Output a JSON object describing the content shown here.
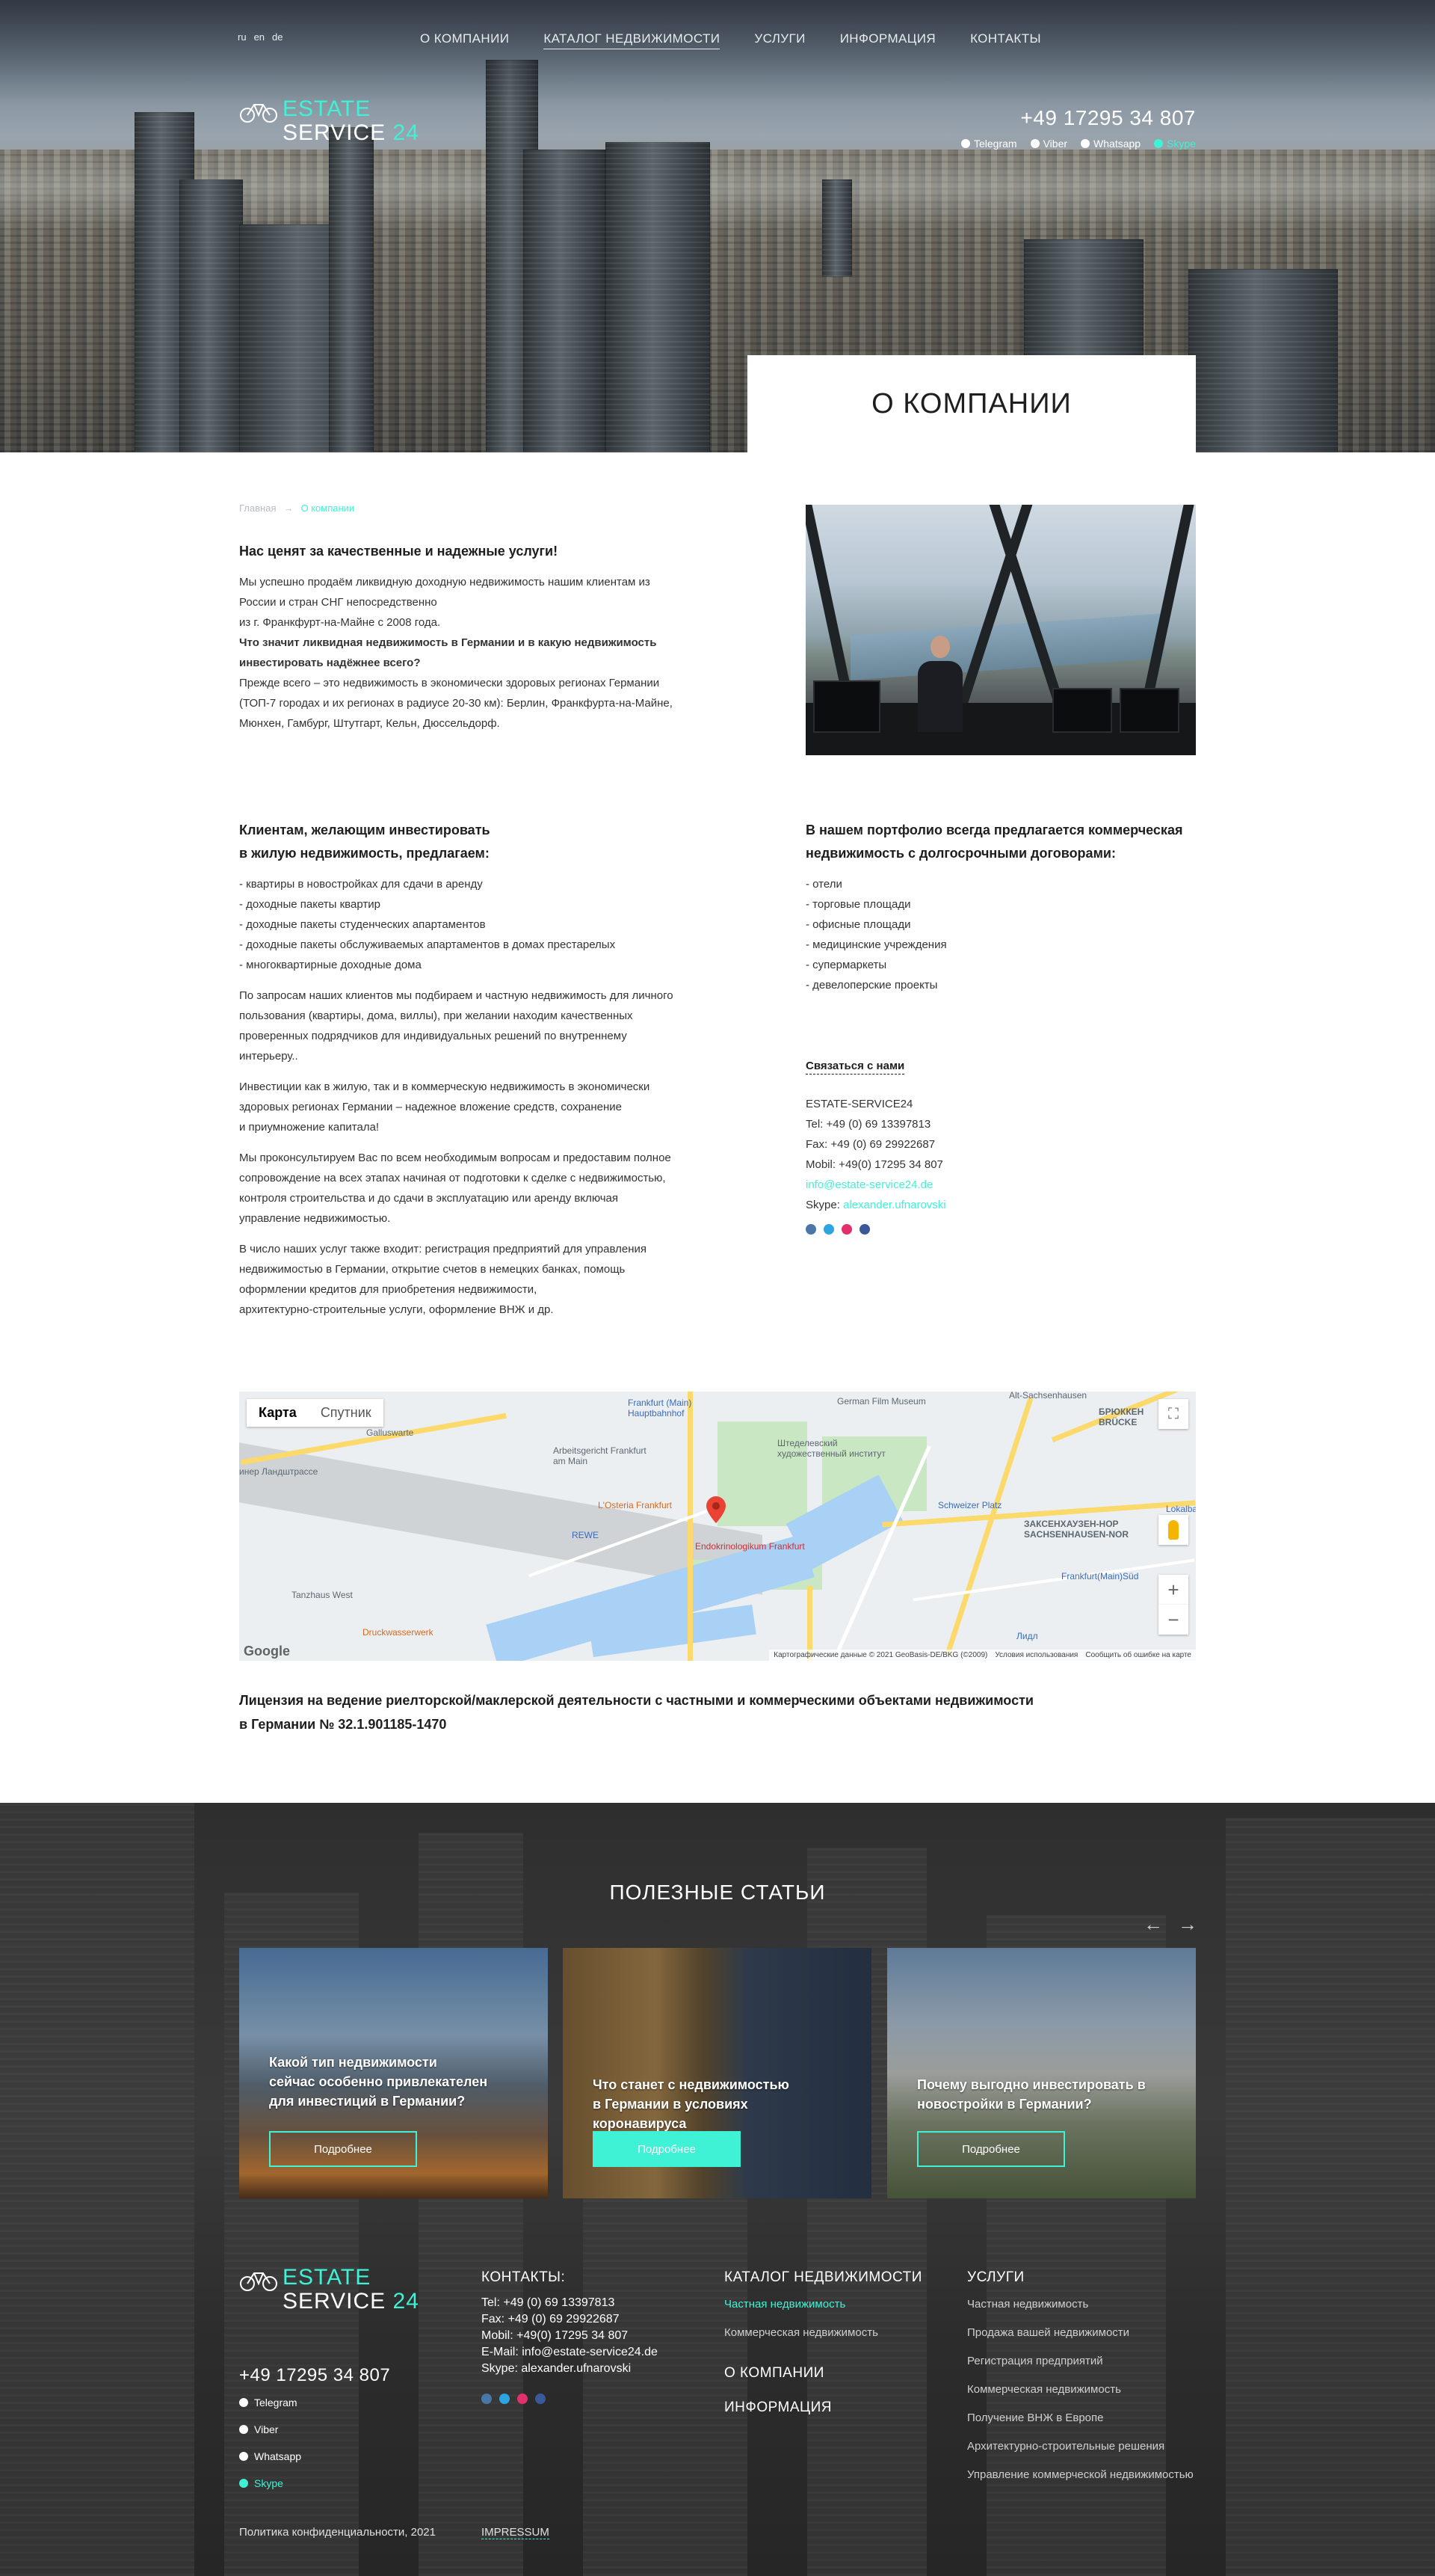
{
  "header": {
    "languages": [
      "ru",
      "en",
      "de"
    ],
    "nav": [
      {
        "label": "О КОМПАНИИ",
        "active": false
      },
      {
        "label": "КАТАЛОГ НЕДВИЖИМОСТИ",
        "active": true
      },
      {
        "label": "УСЛУГИ",
        "active": false
      },
      {
        "label": "ИНФОРМАЦИЯ",
        "active": false
      },
      {
        "label": "КОНТАКТЫ",
        "active": false
      }
    ],
    "logo": {
      "line1": "ESTATE",
      "line2": "SERVICE",
      "num": "24",
      "icon": "bicycle-icon"
    },
    "phone": "+49 17295 34 807",
    "messengers": [
      {
        "label": "Telegram",
        "icon": "telegram-icon"
      },
      {
        "label": "Viber",
        "icon": "viber-icon"
      },
      {
        "label": "Whatsapp",
        "icon": "whatsapp-icon"
      },
      {
        "label": "Skype",
        "icon": "skype-icon"
      }
    ],
    "page_title": "О КОМПАНИИ"
  },
  "breadcrumb": {
    "home": "Главная",
    "separator": "→",
    "current": "О компании"
  },
  "intro": {
    "heading": "Нас ценят за качественные и надежные услуги!",
    "p1_line1": "Мы успешно продаём ликвидную доходную недвижимость нашим клиентам из",
    "p1_line2": "России и стран СНГ непосредственно",
    "p1_line3": "из г. Франкфурт-на-Майне с  2008 года.",
    "question_line1": "Что значит ликвидная недвижимость в Германии и в какую недвижимость",
    "question_line2": "инвестировать надёжнее всего?",
    "answer_line1": "Прежде всего – это недвижимость в экономически здоровых регионах Германии",
    "answer_line2": "(ТОП-7 городах и их регионах в радиусе 20-30 км): Берлин, Франкфурта-на-Майне,",
    "answer_line3": "Мюнхен, Гамбург, Штутгарт, Кельн, Дюссельдорф."
  },
  "residential": {
    "heading_line1": "Клиентам, желающим инвестировать",
    "heading_line2": "в жилую недвижимость, предлагаем:",
    "items": [
      "- квартиры в новостройках для сдачи в аренду",
      "- доходные пакеты квартир",
      "- доходные пакеты студенческих апартаментов",
      "- доходные пакеты обслуживаемых апартаментов в домах престарелых",
      "- многоквартирные доходные дома"
    ],
    "p_private": [
      "По запросам наших клиентов мы подбираем и частную недвижимость для личного",
      "пользования (квартиры, дома, виллы), при желании находим качественных",
      "проверенных подрядчиков для индивидуальных решений по внутреннему",
      "интерьеру.."
    ],
    "p_invest": [
      "Инвестиции как в жилую, так и в коммерческую недвижимость в экономически",
      "здоровых регионах Германии – надежное вложение средств, сохранение",
      "и приумножение капитала!"
    ],
    "p_consult": [
      "Мы проконсультируем Вас по всем необходимым вопросам и предоставим полное",
      "сопровождение на всех этапах начиная от подготовки к сделке с недвижимостью,",
      "контроля строительства и до сдачи в эксплуатацию или аренду включая",
      "управление недвижимостью."
    ],
    "p_services": [
      "В число наших услуг также входит: регистрация предприятий для управления",
      "недвижимостью в Германии, открытие счетов в немецких банках, помощь",
      "оформлении кредитов для приобретения недвижимости,",
      "архитектурно-строительные услуги, оформление ВНЖ и др."
    ]
  },
  "commercial": {
    "heading_line1": "В нашем портфолио всегда предлагается коммерческая",
    "heading_line2": "недвижимость с долгосрочными договорами:",
    "items": [
      "- отели",
      "- торговые площади",
      "- офисные площади",
      "- медицинские учреждения",
      "- супермаркеты",
      "- девелоперские проекты"
    ]
  },
  "contact": {
    "heading": "Связаться с нами",
    "company": "ESTATE-SERVICE24",
    "tel": "Tel: +49 (0) 69 13397813",
    "fax": "Fax: +49 (0) 69 29922687",
    "mobil": "Mobil: +49(0) 17295 34 807",
    "email": "info@estate-service24.de",
    "skype_label": "Skype:",
    "skype": "alexander.ufnarovski",
    "socials": [
      "vk-icon",
      "telegram-icon",
      "instagram-icon",
      "facebook-icon"
    ]
  },
  "map": {
    "tab_map": "Карта",
    "tab_satellite": "Спутник",
    "labels": {
      "galluswarte": "Galluswarte",
      "arbeitsgericht": "Arbeitsgericht Frankfurt am Main",
      "hauptbahnhof": "Frankfurt (Main) Hauptbahnhof",
      "lostetia": "L'Osteria Frankfurt",
      "rewe": "REWE",
      "endo": "Endokrinologikum Frankfurt",
      "tanzhaus": "Tanzhaus West",
      "druck": "Druckwasserwerk",
      "schweizer": "Schweizer Platz",
      "sachsenhausen": "ЗАКСЕНХАУЗЕН-НОР SACHSENHAUSEN-NOR",
      "brucken": "БРЮККЕН BRÜCKE",
      "lokal": "Lokalbahnh",
      "sudbf": "Frankfurt(Main)Süd",
      "lidl": "Лидл",
      "staedel": "Штеделевский художественный институт",
      "film": "German Film Museum",
      "alt": "Alt-Sachsenhausen",
      "mannheimer": "инер Ландштрассе"
    },
    "google": "Google",
    "footer_data": "Картографические данные © 2021 GeoBasis-DE/BKG (©2009)",
    "footer_terms": "Условия использования",
    "footer_report": "Сообщить об ошибке на карте"
  },
  "license": {
    "line1": "Лицензия на ведение риелторской/маклерской деятельности с частными и коммерческими объектами недвижимости",
    "line2": "в Германии № 32.1.901185-1470"
  },
  "articles": {
    "title": "ПОЛЕЗНЫЕ СТАТЬИ",
    "prev": "←",
    "next": "→",
    "items": [
      {
        "title_l1": "Какой тип недвижимости",
        "title_l2": "сейчас особенно привлекателен",
        "title_l3": "для инвестиций в Германии?",
        "button": "Подробнее"
      },
      {
        "title_l1": "Что станет с недвижимостью",
        "title_l2": "в Германии в условиях коронавируса",
        "title_l3": "",
        "button": "Подробнее"
      },
      {
        "title_l1": "Почему выгодно инвестировать в",
        "title_l2": "новостройки в Германии?",
        "title_l3": "",
        "button": "Подробнее"
      }
    ]
  },
  "footer": {
    "phone": "+49 17295 34 807",
    "messengers": [
      "Telegram",
      "Viber",
      "Whatsapp",
      "Skype"
    ],
    "contacts": {
      "heading": "КОНТАКТЫ:",
      "tel": "Tel: +49 (0) 69 13397813",
      "fax": "Fax: +49 (0) 69 29922687",
      "mobil": "Mobil: +49(0) 17295 34 807",
      "email": "E-Mail: info@estate-service24.de",
      "skype": "Skype: alexander.ufnarovski"
    },
    "catalog": {
      "heading": "КАТАЛОГ НЕДВИЖИМОСТИ",
      "links": [
        "Частная недвижимость",
        "Коммерческая недвижимость"
      ]
    },
    "about": "О КОМПАНИИ",
    "info": "ИНФОРМАЦИЯ",
    "services": {
      "heading": "УСЛУГИ",
      "links": [
        "Частная недвижимость",
        "Продажа вашей недвижимости",
        "Регистрация предприятий",
        "Коммерческая недвижимость",
        "Получение ВНЖ в Европе",
        "Архитектурно-строительные решения",
        "Управление коммерческой недвижимостью"
      ]
    },
    "privacy": "Политика конфиденциальности, 2021",
    "impressum": "IMPRESSUM"
  },
  "colors": {
    "accent": "#3ff2d5",
    "dark_bg": "#2e2e2e",
    "text": "#333333"
  }
}
